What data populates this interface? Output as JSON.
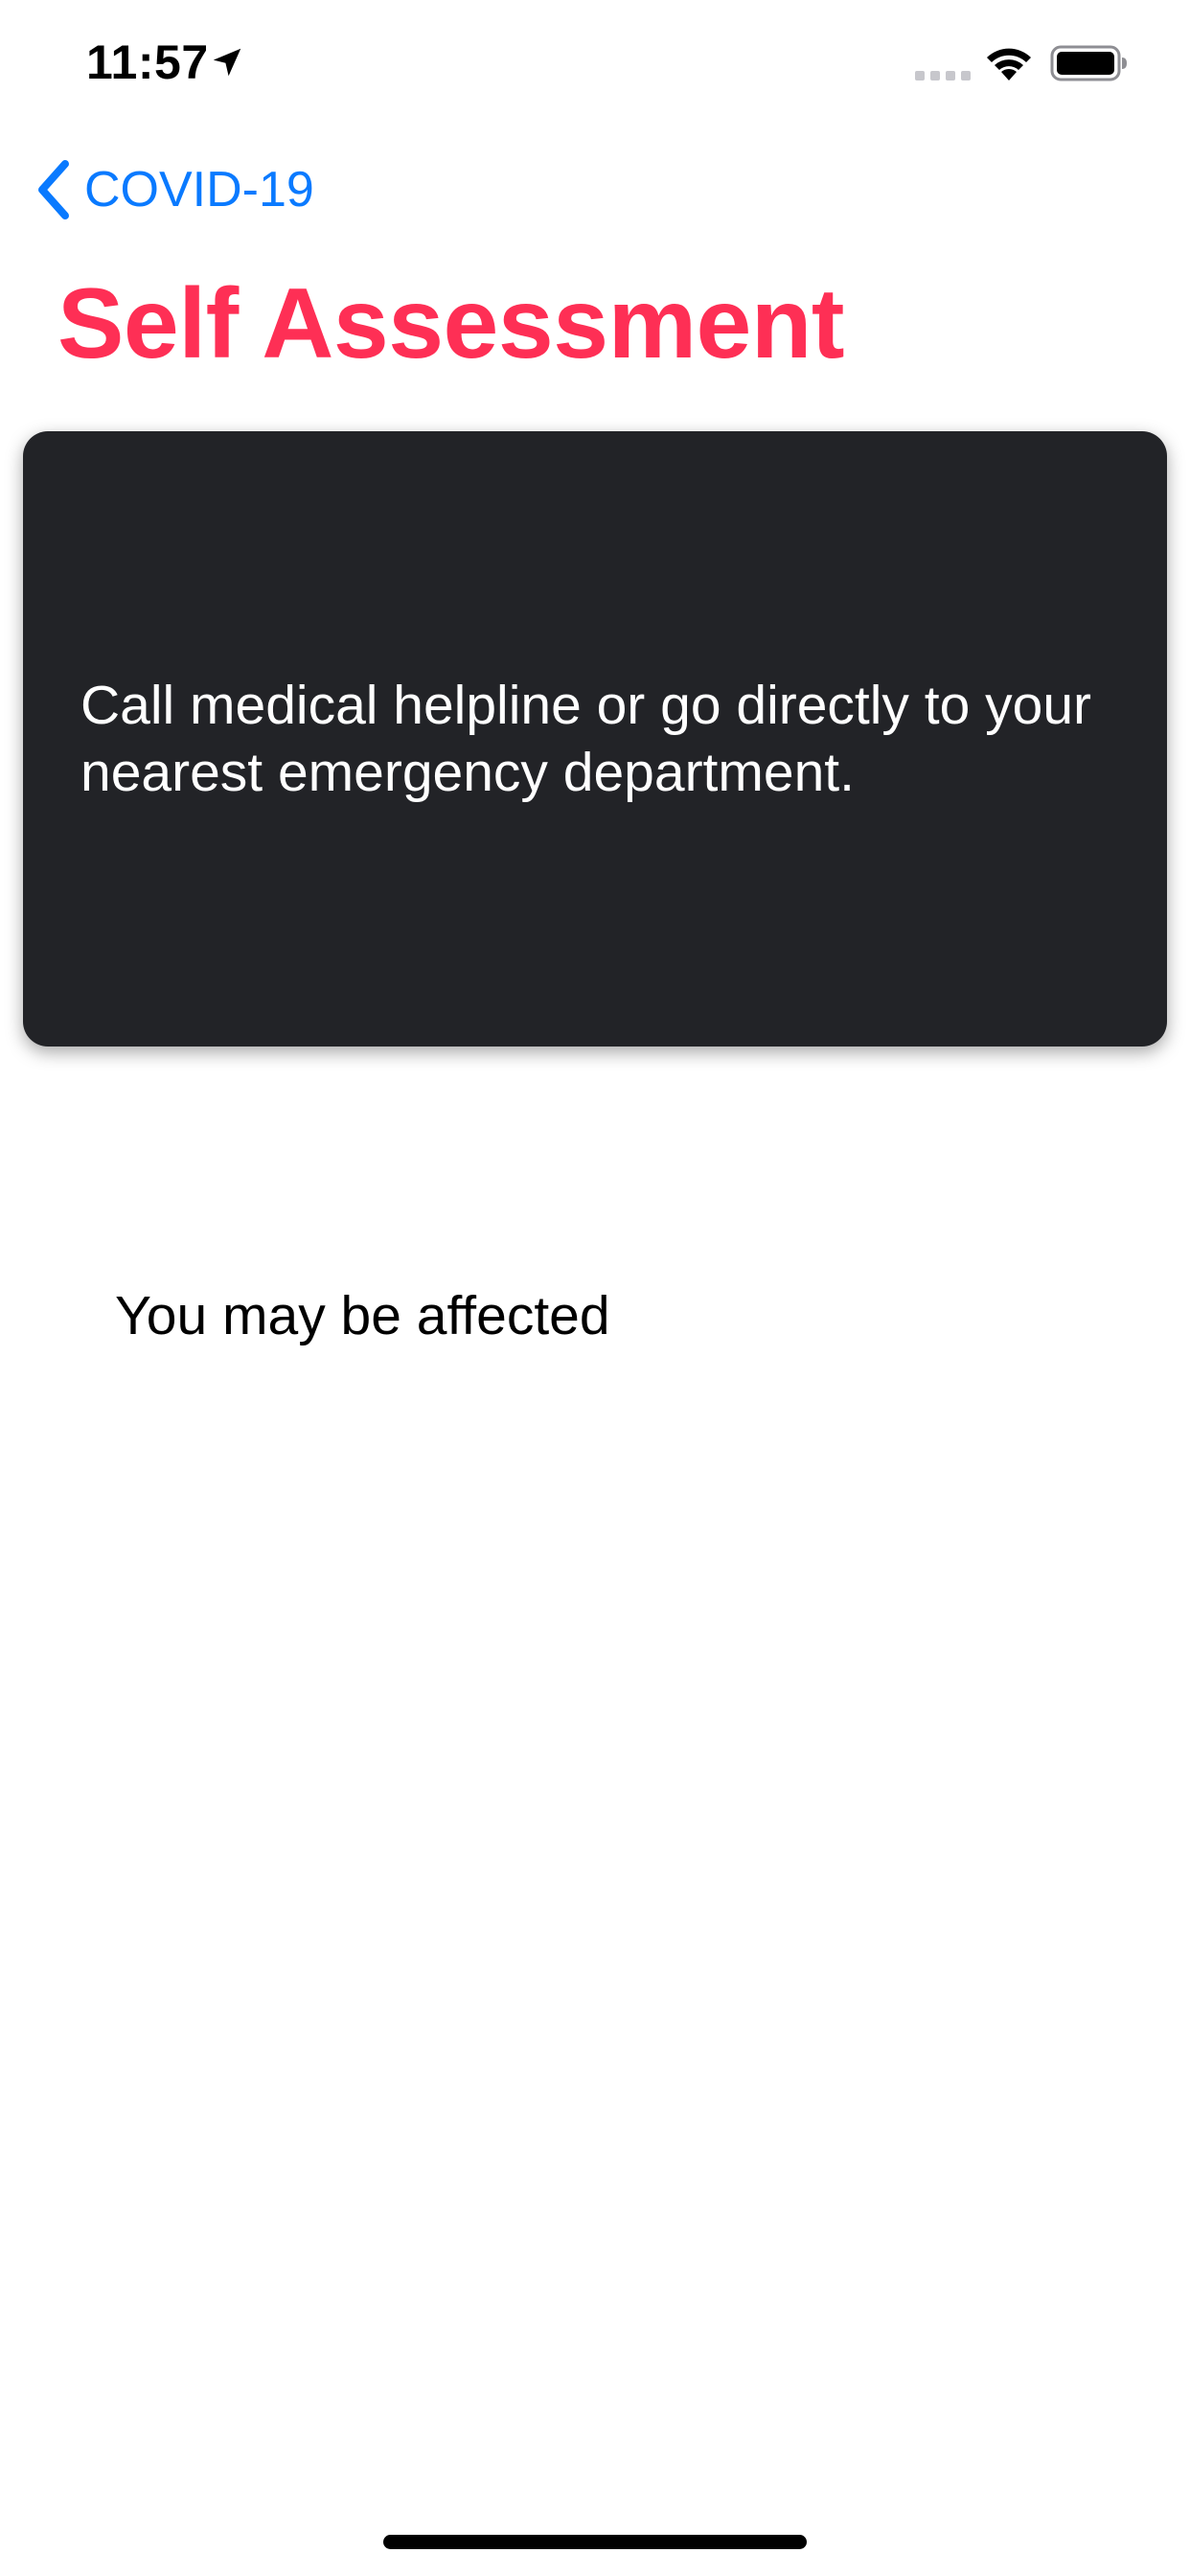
{
  "status_bar": {
    "time": "11:57",
    "icons": [
      "location-arrow-icon",
      "cellular-signal-icon",
      "wifi-icon",
      "battery-icon"
    ]
  },
  "navigation": {
    "back_label": "COVID-19",
    "back_icon": "chevron-left-icon",
    "title": "Self Assessment"
  },
  "card": {
    "message": "Call medical helpline or go directly to your nearest emergency department."
  },
  "result": {
    "label": "You may be affected"
  },
  "colors": {
    "accent_blue": "#0a7aff",
    "title_red": "#fe2f55",
    "card_background": "#222327"
  }
}
